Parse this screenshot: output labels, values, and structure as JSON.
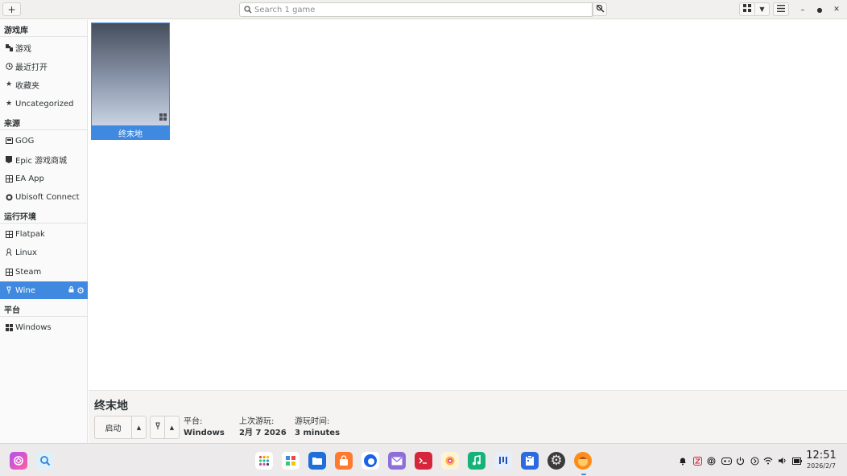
{
  "header": {
    "search_placeholder": "Search 1 game",
    "add_label": "+"
  },
  "sidebar": {
    "sections": [
      {
        "title": "游戏库",
        "items": [
          {
            "label": "游戏",
            "icon": "gamepad-icon"
          },
          {
            "label": "最近打开",
            "icon": "clock-icon"
          },
          {
            "label": "收藏夹",
            "icon": "star-icon"
          },
          {
            "label": "Uncategorized",
            "icon": "star-icon"
          }
        ]
      },
      {
        "title": "来源",
        "items": [
          {
            "label": "GOG",
            "icon": "gog-icon"
          },
          {
            "label": "Epic 游戏商城",
            "icon": "epic-icon"
          },
          {
            "label": "EA App",
            "icon": "ea-icon"
          },
          {
            "label": "Ubisoft Connect",
            "icon": "ubisoft-icon"
          }
        ]
      },
      {
        "title": "运行环境",
        "items": [
          {
            "label": "Flatpak",
            "icon": "flatpak-icon"
          },
          {
            "label": "Linux",
            "icon": "linux-icon"
          },
          {
            "label": "Steam",
            "icon": "steam-icon"
          },
          {
            "label": "Wine",
            "icon": "wine-icon",
            "selected": true
          }
        ]
      },
      {
        "title": "平台",
        "items": [
          {
            "label": "Windows",
            "icon": "windows-icon"
          }
        ]
      }
    ]
  },
  "games": [
    {
      "title": "终末地",
      "platform_icon": "windows-icon"
    }
  ],
  "game_bar": {
    "title": "终末地",
    "launch_label": "启动",
    "platform_key": "平台:",
    "platform_value": "Windows",
    "last_played_key": "上次游玩:",
    "last_played_value": "2月 7 2026",
    "playtime_key": "游玩时间:",
    "playtime_value": "3 minutes"
  },
  "taskbar": {
    "time": "12:51",
    "date": "2026/2/7"
  },
  "colors": {
    "accent": "#3f8ae0",
    "sidebar_bg": "#fafafa",
    "header_bg": "#f1f0ee"
  }
}
